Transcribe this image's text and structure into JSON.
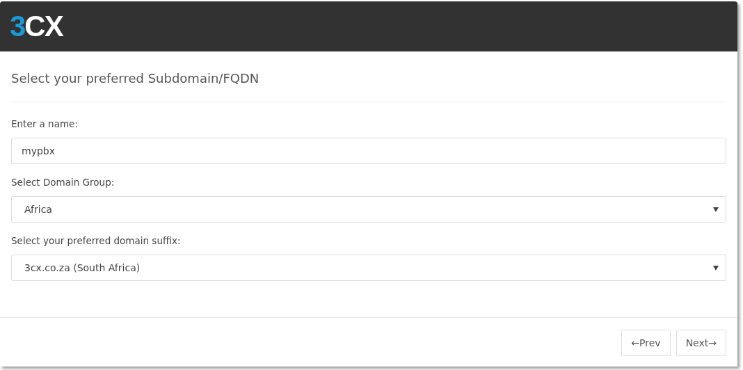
{
  "logo": {
    "accent": "3",
    "rest": "CX"
  },
  "title": "Select your preferred Subdomain/FQDN",
  "fields": [
    {
      "kind": "text",
      "label": "Enter a name:",
      "value": "mypbx"
    },
    {
      "kind": "select",
      "label": "Select Domain Group:",
      "value": "Africa"
    },
    {
      "kind": "select",
      "label": "Select your preferred domain suffix:",
      "value": "3cx.co.za (South Africa)"
    }
  ],
  "buttons": [
    "←Prev",
    "Next→"
  ]
}
